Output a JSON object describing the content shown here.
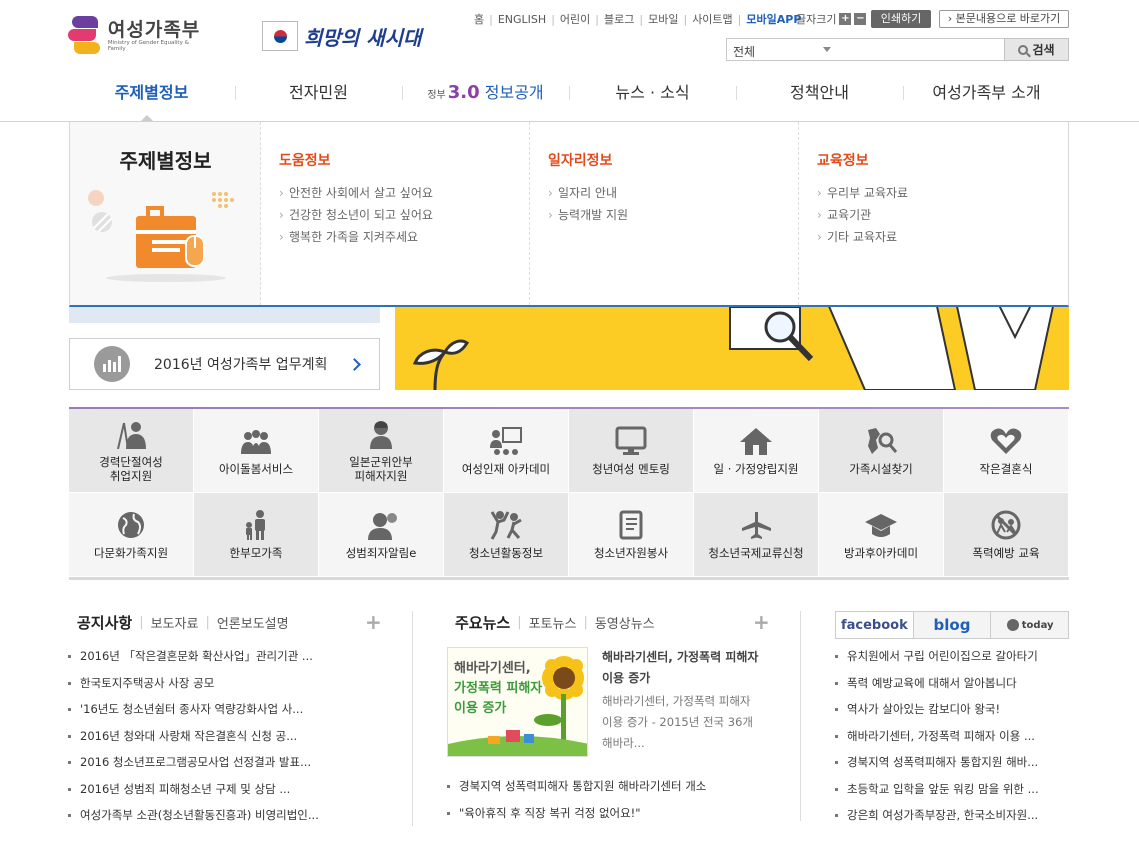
{
  "header": {
    "logo_name": "여성가족부",
    "logo_sub": "Ministry of Gender Equality & Family",
    "slogan": "희망의 새시대"
  },
  "util_links": [
    "홈",
    "ENGLISH",
    "어린이",
    "블로그",
    "모바일",
    "사이트맵",
    "모바일APP"
  ],
  "font_size_label": "글자크기",
  "font_plus": "+",
  "font_minus": "−",
  "print_label": "인쇄하기",
  "skip_label": "본문내용으로 바로가기",
  "search": {
    "scope_value": "전체",
    "button_label": "검색"
  },
  "gnb": {
    "items": [
      "주제별정보",
      "전자민원",
      "정보공개",
      "뉴스 · 소식",
      "정책안내",
      "여성가족부 소개"
    ],
    "badge_prefix": "정부",
    "badge_num": "3.0"
  },
  "mega": {
    "title": "주제별정보",
    "columns": [
      {
        "heading": "도움정보",
        "links": [
          "안전한 사회에서 살고 싶어요",
          "건강한 청소년이 되고 싶어요",
          "행복한 가족을 지켜주세요"
        ]
      },
      {
        "heading": "일자리정보",
        "links": [
          "일자리 안내",
          "능력개발 지원"
        ]
      },
      {
        "heading": "교육정보",
        "links": [
          "우리부 교육자료",
          "교육기관",
          "기타 교육자료"
        ]
      }
    ]
  },
  "plan_card": {
    "label": "2016년 여성가족부 업무계획"
  },
  "services": [
    "경력단절여성\n취업지원",
    "아이돌봄서비스",
    "일본군위안부\n피해자지원",
    "여성인재 아카데미",
    "청년여성 멘토링",
    "일 · 가정양립지원",
    "가족시설찾기",
    "작은결혼식",
    "다문화가족지원",
    "한부모가족",
    "성범죄자알림e",
    "청소년활동정보",
    "청소년자원봉사",
    "청소년국제교류신청",
    "방과후아카데미",
    "폭력예방 교육"
  ],
  "notice": {
    "tabs": [
      "공지사항",
      "보도자료",
      "언론보도설명"
    ],
    "items": [
      "2016년 「작은결혼문화 확산사업」관리기관 ...",
      "한국토지주택공사 사장 공모",
      "'16년도 청소년쉼터 종사자 역량강화사업 사...",
      "2016년 청와대 사랑채 작은결혼식 신청 공...",
      "2016 청소년프로그램공모사업 선정결과 발표...",
      "2016년 성범죄 피해청소년 구제 및 상담 ...",
      "여성가족부 소관(청소년활동진흥과) 비영리법인..."
    ]
  },
  "news": {
    "tabs": [
      "주요뉴스",
      "포토뉴스",
      "동영상뉴스"
    ],
    "thumb_text": [
      "해바라기센터,",
      "가정폭력 피해자",
      "이용 증가"
    ],
    "headline": "해바라기센터, 가정폭력 피해자 이용 증가",
    "body": "해바라기센터, 가정폭력 피해자 이용 증가 - 2015년 전국 36개 해바라...",
    "items": [
      "경북지역 성폭력피해자 통합지원 해바라기센터 개소",
      "\"육아휴직 후 직장 복귀 걱정 없어요!\""
    ]
  },
  "sns": {
    "tabs": [
      "facebook",
      "blog",
      "today"
    ],
    "items": [
      "유치원에서 구립 어린이집으로 갈아타기",
      "폭력 예방교육에 대해서 알아봅니다",
      "역사가 살아있는 캄보디아 왕국!",
      "해바라기센터, 가정폭력 피해자 이용 ...",
      "경북지역 성폭력피해자 통합지원 해바...",
      "초등학교 입학을 앞둔 워킹 맘을 위한 ...",
      "강은희 여성가족부장관, 한국소비자원..."
    ]
  },
  "colors": {
    "primary_blue": "#1f5fb8",
    "accent_orange": "#e44b1c",
    "banner_yellow": "#fccc24"
  }
}
